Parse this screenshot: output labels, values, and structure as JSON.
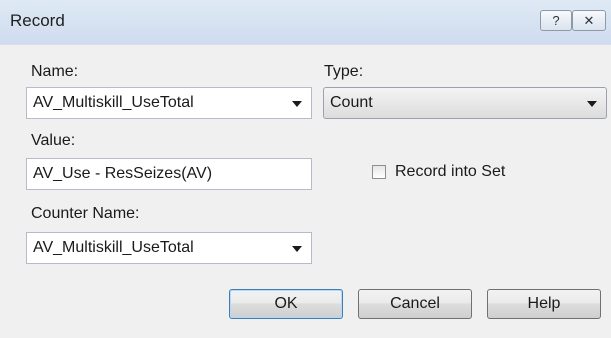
{
  "window": {
    "title": "Record",
    "help_glyph": "?",
    "close_glyph": "✕"
  },
  "form": {
    "name_label": "Name:",
    "name_value": "AV_Multiskill_UseTotal",
    "type_label": "Type:",
    "type_value": "Count",
    "value_label": "Value:",
    "value_value": "AV_Use - ResSeizes(AV)",
    "record_into_set_label": "Record into Set",
    "record_into_set_checked": false,
    "counter_name_label": "Counter Name:",
    "counter_name_value": "AV_Multiskill_UseTotal"
  },
  "buttons": {
    "ok_label": "OK",
    "cancel_label": "Cancel",
    "help_label": "Help"
  }
}
